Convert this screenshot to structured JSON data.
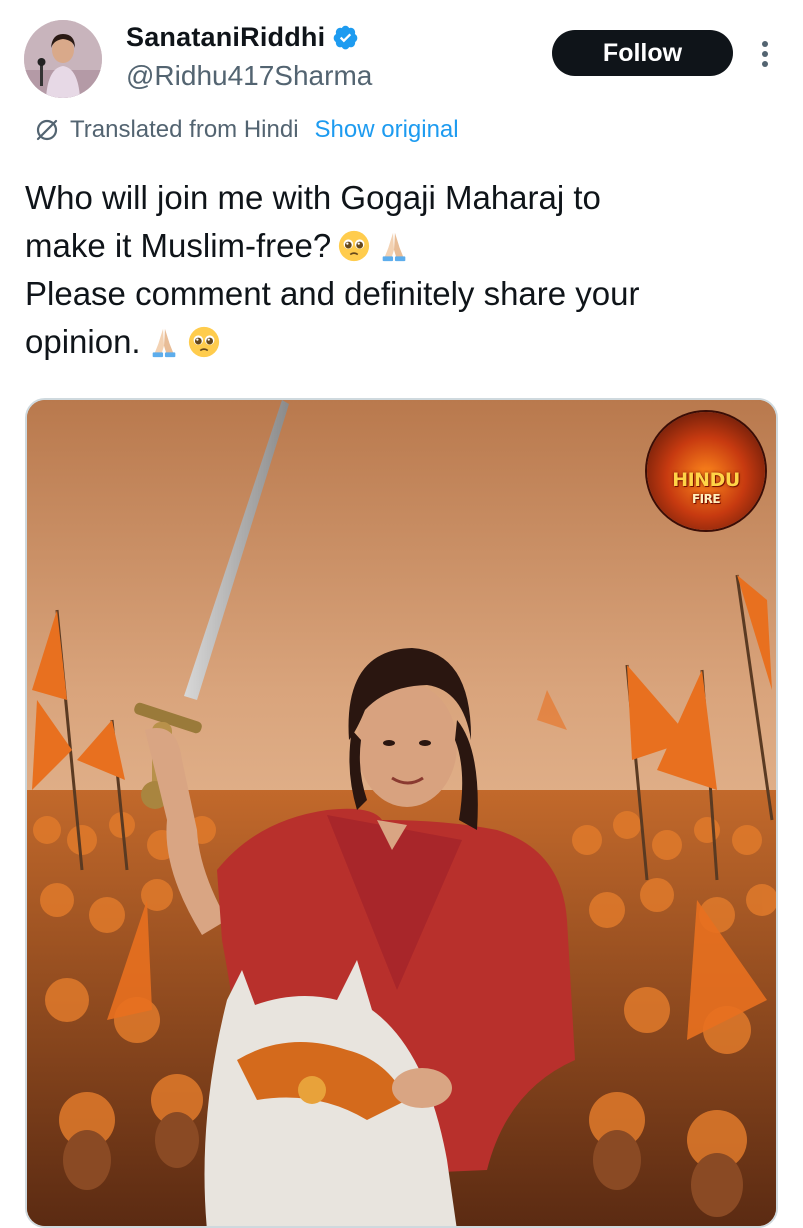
{
  "author": {
    "display_name": "SanataniRiddhi",
    "handle": "@Ridhu417Sharma",
    "verified": true,
    "avatar_icon": "profile-photo"
  },
  "actions": {
    "follow_label": "Follow",
    "more_icon": "more-vertical-icon"
  },
  "translation": {
    "label": "Translated from Hindi",
    "show_original": "Show original",
    "icon": "translate-icon"
  },
  "tweet": {
    "lines": [
      "Who will join me with Gogaji Maharaj to",
      "make it Muslim-free?",
      "Please comment and definitely share your",
      "opinion."
    ],
    "emojis": [
      "pleading-face",
      "folded-hands"
    ]
  },
  "media": {
    "logo_text": "HINDU",
    "logo_subtext": "FIRE"
  },
  "colors": {
    "accent": "#1d9bf0",
    "text": "#0f1419",
    "secondary_text": "#536471",
    "follow_bg": "#0f1419",
    "saffron": "#e8701f"
  }
}
